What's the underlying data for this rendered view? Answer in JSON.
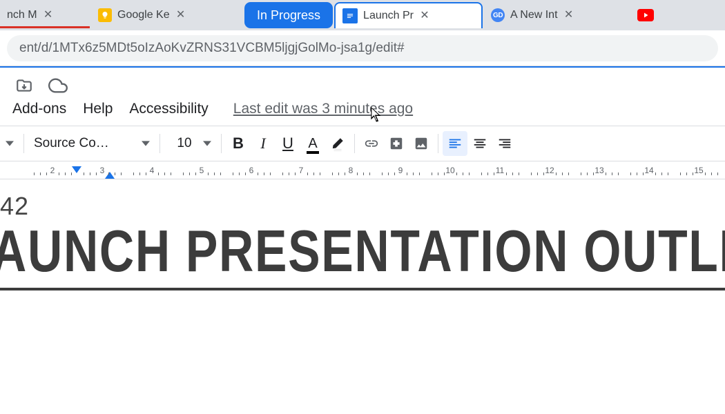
{
  "tabs": [
    {
      "label": "nch M",
      "kind": "generic"
    },
    {
      "label": "Google Ke",
      "kind": "keep"
    },
    {
      "label": "In Progress",
      "kind": "pill"
    },
    {
      "label": "Launch Pr",
      "kind": "docs",
      "active": true
    },
    {
      "label": "A New Int",
      "kind": "gd"
    },
    {
      "label": "",
      "kind": "youtube"
    }
  ],
  "addressbar": {
    "url": "ent/d/1MTx6z5MDt5oIzAoKvZRNS31VCBM5ljgjGolMo-jsa1g/edit#"
  },
  "menus": {
    "addons": "Add-ons",
    "help": "Help",
    "accessibility": "Accessibility",
    "edit_status": "Last edit was 3 minutes ago"
  },
  "toolbar": {
    "font_name": "Source Co…",
    "font_size": "10"
  },
  "ruler": {
    "numbers": [
      "2",
      "3",
      "4",
      "5",
      "6",
      "7",
      "8",
      "9",
      "10",
      "11",
      "12",
      "13",
      "14",
      "15"
    ]
  },
  "doc": {
    "pretitle": "42",
    "title": "AUNCH PRESENTATION OUTLINE"
  }
}
